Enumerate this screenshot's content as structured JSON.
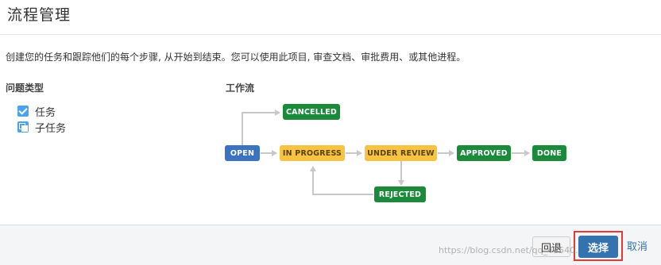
{
  "dialog": {
    "title": "流程管理",
    "description": "创建您的任务和跟踪他们的每个步骤, 从开始到结束。您可以使用此项目, 审查文档、审批费用、或其他进程。"
  },
  "issue_types": {
    "label": "问题类型",
    "items": [
      {
        "label": "任务",
        "icon": "task-icon"
      },
      {
        "label": "子任务",
        "icon": "subtask-icon"
      }
    ]
  },
  "workflow": {
    "label": "工作流",
    "statuses": {
      "open": "OPEN",
      "in_progress": "IN PROGRESS",
      "under_review": "UNDER REVIEW",
      "approved": "APPROVED",
      "done": "DONE",
      "cancelled": "CANCELLED",
      "rejected": "REJECTED"
    },
    "colors": {
      "blue": "#3b73c0",
      "yellow": "#f6c343",
      "green": "#1b8a3a"
    }
  },
  "footer": {
    "back_label": "回退",
    "select_label": "选择",
    "cancel_label": "取消"
  },
  "watermark": "https://blog.csdn.net/qq_43540..."
}
